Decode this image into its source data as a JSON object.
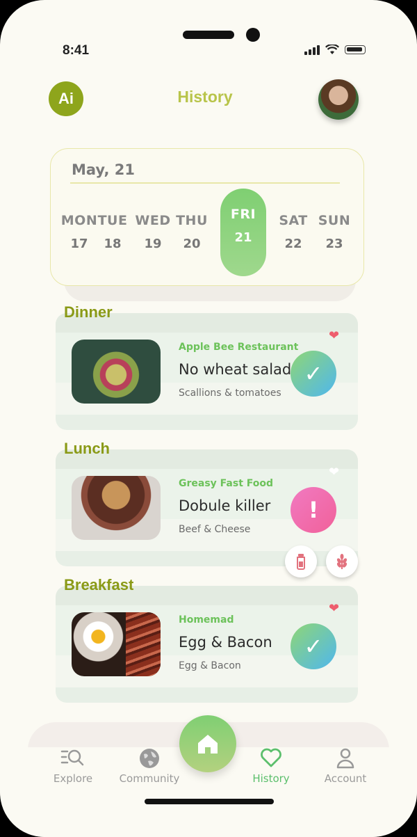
{
  "status_bar": {
    "time": "8:41",
    "signal_icon": "signal-icon",
    "wifi_icon": "wifi-icon",
    "battery_icon": "battery-icon"
  },
  "header": {
    "logo_text": "Ai",
    "title": "History",
    "avatar_icon": "avatar"
  },
  "calendar": {
    "month": "May, 21",
    "days": [
      {
        "name": "MON",
        "date": "17"
      },
      {
        "name": "TUE",
        "date": "18"
      },
      {
        "name": "WED",
        "date": "19"
      },
      {
        "name": "THU",
        "date": "20"
      },
      {
        "name": "FRI",
        "date": "21",
        "active": true
      },
      {
        "name": "SAT",
        "date": "22"
      },
      {
        "name": "SUN",
        "date": "23"
      }
    ]
  },
  "meals": [
    {
      "label": "Dinner",
      "source": "Apple Bee Restaurant",
      "title": "No wheat salad",
      "subtitle": "Scallions & tomatoes",
      "status": "ok",
      "favorite": true
    },
    {
      "label": "Lunch",
      "source": "Greasy Fast Food",
      "title": "Dobule killer",
      "subtitle": "Beef & Cheese",
      "status": "warning",
      "favorite": false
    },
    {
      "label": "Breakfast",
      "source": "Homemad",
      "title": "Egg & Bacon",
      "subtitle": "Egg & Bacon",
      "status": "ok",
      "favorite": true
    }
  ],
  "warning_chips": [
    "milk-bottle-icon",
    "wheat-icon"
  ],
  "nav": {
    "items": [
      {
        "label": "Explore",
        "icon": "explore-icon"
      },
      {
        "label": "Community",
        "icon": "globe-icon"
      },
      {
        "label": "History",
        "icon": "heart-icon",
        "active": true
      },
      {
        "label": "Account",
        "icon": "person-icon"
      }
    ],
    "home_icon": "home-icon"
  },
  "colors": {
    "accent": "#8ea51c",
    "green": "#6cc25a",
    "ok_gradient": [
      "#8fd675",
      "#4fb7ee"
    ],
    "warn_gradient": [
      "#f17ac1",
      "#f1619a"
    ]
  }
}
